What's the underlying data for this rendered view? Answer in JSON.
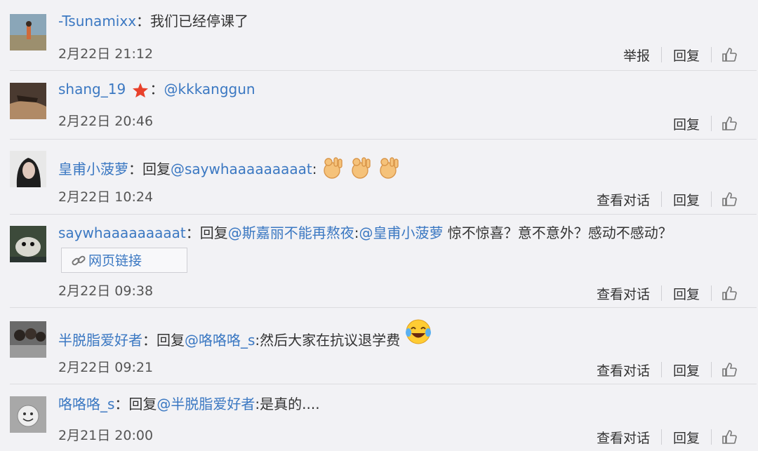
{
  "comments": [
    {
      "user": "-Tsunamixx",
      "sep": "：",
      "text": "我们已经停课了",
      "time": "2月22日 21:12",
      "actions": {
        "report": "举报",
        "reply": "回复"
      }
    },
    {
      "user": "shang_19",
      "sep": "：",
      "mention": "@kkkanggun",
      "time": "2月22日 20:46",
      "actions": {
        "reply": "回复"
      }
    },
    {
      "user": "皇甫小菠萝",
      "sep": "：",
      "prefix": "回复",
      "mention": "@saywhaaaaaaaaat",
      "after": ":",
      "time": "2月22日 10:24",
      "actions": {
        "view": "查看对话",
        "reply": "回复"
      }
    },
    {
      "user": "saywhaaaaaaaaat",
      "sep": "：",
      "prefix": "回复",
      "mention": "@斯嘉丽不能再熬夜",
      "after": ":",
      "mention2": "@皇甫小菠萝",
      "text": " 惊不惊喜？意不意外？感动不感动？",
      "link_card": "网页链接",
      "time": "2月22日 09:38",
      "actions": {
        "view": "查看对话",
        "reply": "回复"
      }
    },
    {
      "user": "半脱脂爱好者",
      "sep": "：",
      "prefix": "回复",
      "mention": "@咯咯咯_s",
      "after": ":然后大家在抗议退学费",
      "time": "2月22日 09:21",
      "actions": {
        "view": "查看对话",
        "reply": "回复"
      }
    },
    {
      "user": "咯咯咯_s",
      "sep": "：",
      "prefix": "回复",
      "mention": "@半脱脂爱好者",
      "after": ":是真的....",
      "time": "2月21日 20:00",
      "actions": {
        "view": "查看对话",
        "reply": "回复"
      }
    }
  ],
  "icons": {
    "like": "thumbs-up-icon",
    "link": "link-icon",
    "badge": "red-star-icon",
    "ok_hand": "ok-hand-emoji",
    "laugh": "tears-of-joy-emoji"
  },
  "colors": {
    "username": "#3b78c2",
    "background": "#f2f2f5",
    "badge": "#e8412b"
  }
}
